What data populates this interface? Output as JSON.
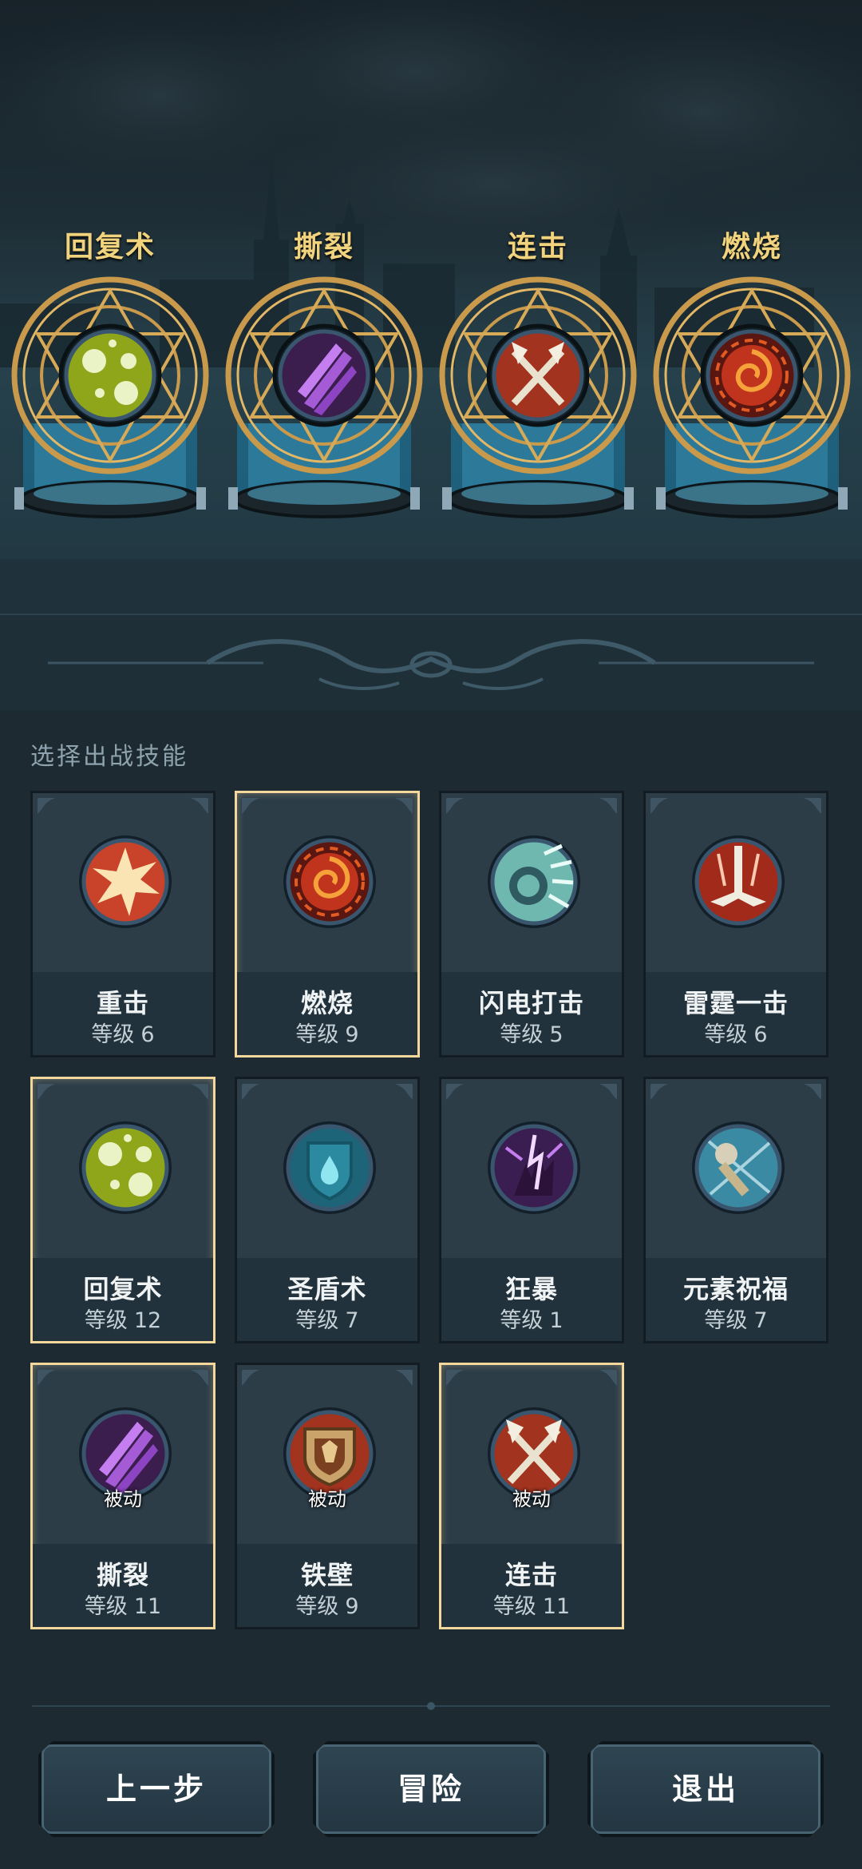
{
  "equipped_slots": [
    {
      "name": "回复术",
      "icon": "green-orb-icon"
    },
    {
      "name": "撕裂",
      "icon": "purple-claw-icon"
    },
    {
      "name": "连击",
      "icon": "crossed-axes-icon"
    },
    {
      "name": "燃烧",
      "icon": "fire-swirl-icon"
    }
  ],
  "section_title": "选择出战技能",
  "level_prefix": "等级",
  "passive_label": "被动",
  "skills": [
    {
      "name": "重击",
      "level": "6",
      "icon": "burst-icon",
      "selected": false,
      "passive": false
    },
    {
      "name": "燃烧",
      "level": "9",
      "icon": "fire-swirl-icon",
      "selected": true,
      "passive": false
    },
    {
      "name": "闪电打击",
      "level": "5",
      "icon": "lightning-orb-icon",
      "selected": false,
      "passive": false
    },
    {
      "name": "雷霆一击",
      "level": "6",
      "icon": "thunder-sword-icon",
      "selected": false,
      "passive": false
    },
    {
      "name": "回复术",
      "level": "12",
      "icon": "green-orb-icon",
      "selected": true,
      "passive": false
    },
    {
      "name": "圣盾术",
      "level": "7",
      "icon": "holy-shield-icon",
      "selected": false,
      "passive": false
    },
    {
      "name": "狂暴",
      "level": "1",
      "icon": "rage-icon",
      "selected": false,
      "passive": false
    },
    {
      "name": "元素祝福",
      "level": "7",
      "icon": "hammer-blessing-icon",
      "selected": false,
      "passive": false
    },
    {
      "name": "撕裂",
      "level": "11",
      "icon": "purple-claw-icon",
      "selected": true,
      "passive": true
    },
    {
      "name": "铁壁",
      "level": "9",
      "icon": "iron-shield-icon",
      "selected": false,
      "passive": true
    },
    {
      "name": "连击",
      "level": "11",
      "icon": "crossed-axes-icon",
      "selected": true,
      "passive": true
    }
  ],
  "buttons": {
    "prev": "上一步",
    "adventure": "冒险",
    "exit": "退出"
  },
  "colors": {
    "gold": "#f1d27d",
    "selected_border": "#f4d79a",
    "card_bg": "#2c3d48",
    "panel_bg": "#1d2a31"
  }
}
